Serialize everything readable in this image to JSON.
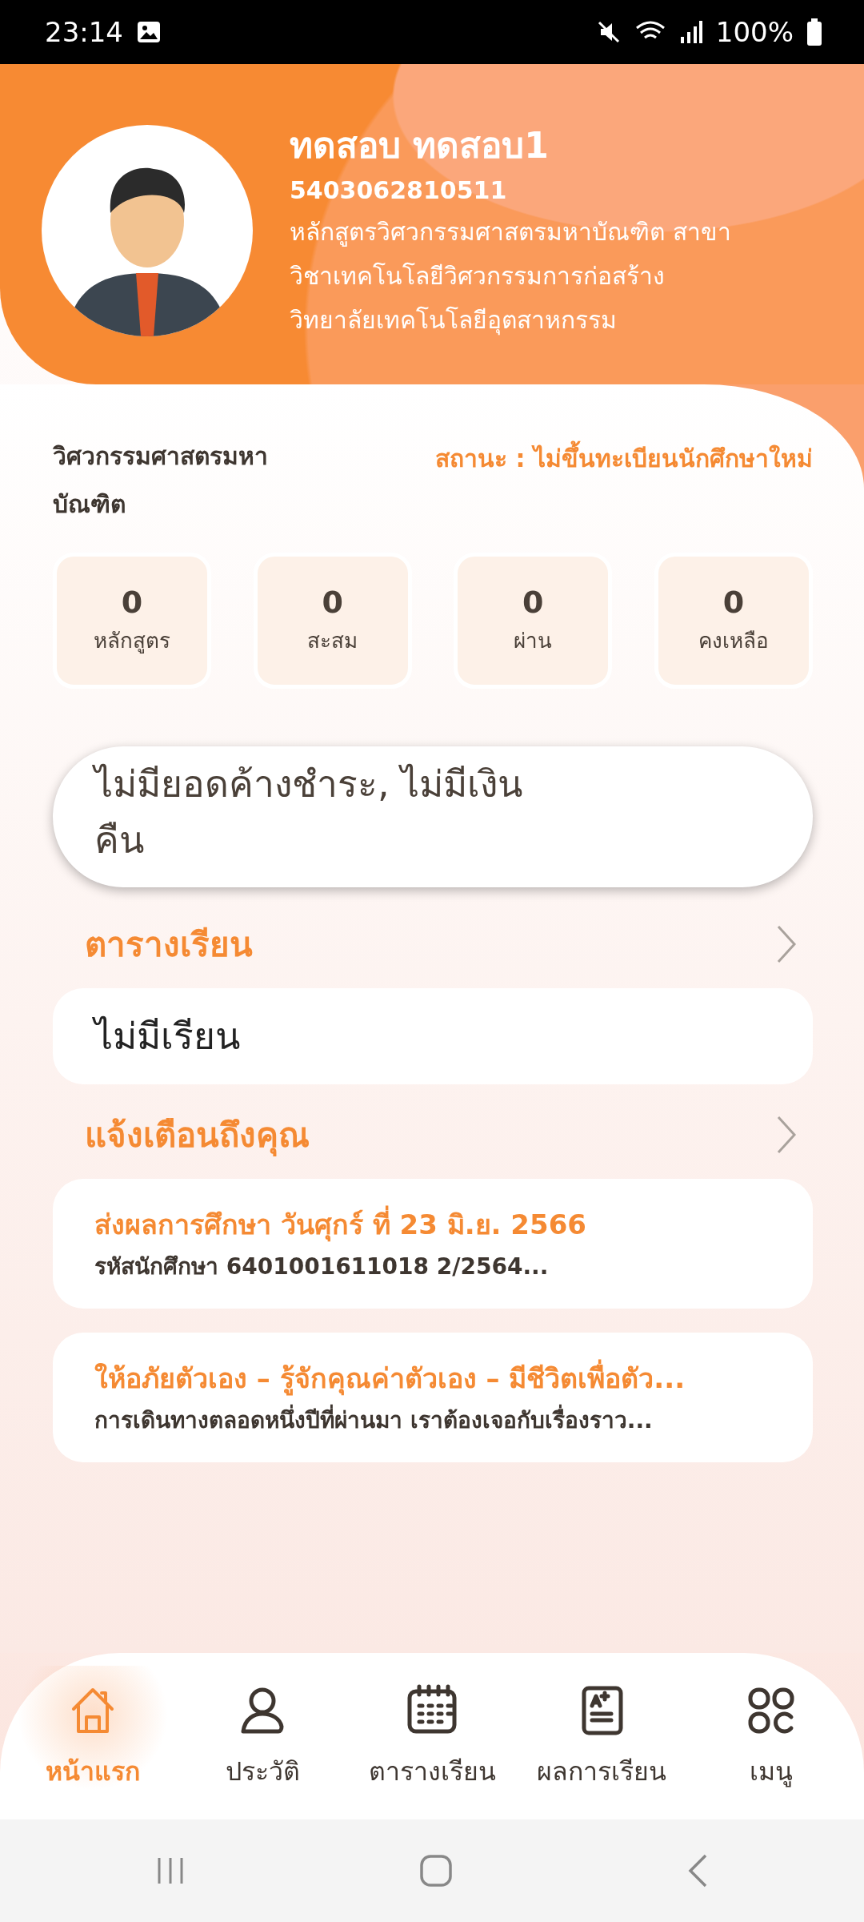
{
  "status_bar": {
    "time": "23:14",
    "battery": "100%"
  },
  "profile": {
    "name": "ทดสอบ ทดสอบ1",
    "student_id": "5403062810511",
    "program_lines": [
      "หลักสูตรวิศวกรรมศาสตรมหาบัณฑิต สาขา",
      "วิชาเทคโนโลยีวิศวกรรมการก่อสร้าง",
      "วิทยาลัยเทคโนโลยีอุตสาหกรรม"
    ]
  },
  "degree_lines": [
    "วิศวกรรมศาสตรมหา",
    "บัณฑิต"
  ],
  "status": "สถานะ : ไม่ขึ้นทะเบียนนักศึกษาใหม่",
  "stats": [
    {
      "value": "0",
      "label": "หลักสูตร"
    },
    {
      "value": "0",
      "label": "สะสม"
    },
    {
      "value": "0",
      "label": "ผ่าน"
    },
    {
      "value": "0",
      "label": "คงเหลือ"
    }
  ],
  "balance_lines": [
    "ไม่มียอดค้างชำระ, ไม่มีเงิน",
    "คืน"
  ],
  "schedule": {
    "title": "ตารางเรียน",
    "empty_text": "ไม่มีเรียน"
  },
  "notifications": {
    "title": "แจ้งเตือนถึงคุณ",
    "items": [
      {
        "title": "ส่งผลการศึกษา วันศุกร์ ที่ 23 มิ.ย. 2566",
        "body": "รหัสนักศึกษา 6401001611018 2/2564..."
      },
      {
        "title": "ให้อภัยตัวเอง – รู้จักคุณค่าตัวเอง – มีชีวิตเพื่อตัว...",
        "body": "การเดินทางตลอดหนึ่งปีที่ผ่านมา เราต้องเจอกับเรื่องราว..."
      }
    ]
  },
  "bottom_nav": [
    {
      "kind": "home",
      "label": "หน้าแรก",
      "selected": true
    },
    {
      "kind": "profile",
      "label": "ประวัติ",
      "selected": false
    },
    {
      "kind": "calendar",
      "label": "ตารางเรียน",
      "selected": false
    },
    {
      "kind": "grades",
      "label": "ผลการเรียน",
      "selected": false
    },
    {
      "kind": "menu",
      "label": "เมนู",
      "selected": false
    }
  ]
}
